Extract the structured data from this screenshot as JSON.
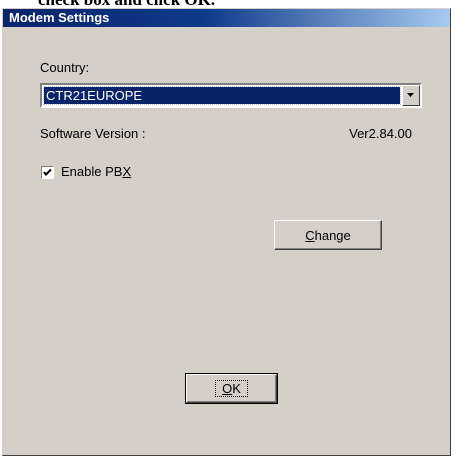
{
  "caption_fragment": "check box and click OK.",
  "window": {
    "title": "Modem Settings"
  },
  "country": {
    "label": "Country:",
    "selected": "CTR21EUROPE"
  },
  "software_version": {
    "label": "Software Version :",
    "value": "Ver2.84.00"
  },
  "enable_pbx": {
    "label_prefix": "Enable PB",
    "mnemonic": "X",
    "checked": true
  },
  "buttons": {
    "change_mnemonic": "C",
    "change_rest": "hange",
    "ok_mnemonic": "O",
    "ok_rest": "K"
  }
}
